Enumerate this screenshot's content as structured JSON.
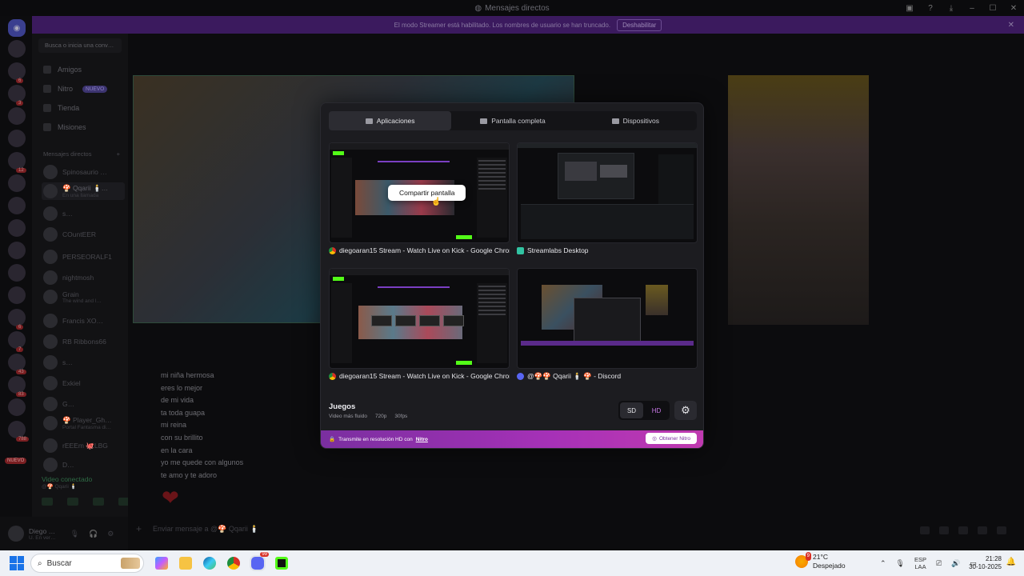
{
  "window": {
    "title": "Mensajes directos",
    "title_icon": "discord-icon"
  },
  "streamer_banner": {
    "text": "El modo Streamer está habilitado. Los nombres de usuario se han truncado.",
    "button": "Deshabilitar"
  },
  "rail": {
    "badges": [
      "6",
      "3",
      "12",
      "6",
      "7",
      "43",
      "83",
      "788"
    ],
    "nuevo_label": "NUEVO"
  },
  "sidebar": {
    "search_placeholder": "Busca o inicia una conv…",
    "nav": [
      {
        "label": "Amigos",
        "icon": "friends-icon"
      },
      {
        "label": "Nitro",
        "icon": "nitro-icon",
        "tag": "NUEVO"
      },
      {
        "label": "Tienda",
        "icon": "shop-icon"
      },
      {
        "label": "Misiones",
        "icon": "quests-icon"
      }
    ],
    "dm_header": "Mensajes directos",
    "dm_add": "+",
    "dms": [
      {
        "name": "Spinosaurio …",
        "sub": ""
      },
      {
        "name": "🍄 Qqarii 🕯️…",
        "sub": "En una llamada"
      },
      {
        "name": "s…",
        "sub": ""
      },
      {
        "name": "COuntEER",
        "sub": ""
      },
      {
        "name": "PERSEORALF1",
        "sub": ""
      },
      {
        "name": "nightmosh",
        "sub": ""
      },
      {
        "name": "Grain",
        "sub": "The wind and l…"
      },
      {
        "name": "Francis XO…",
        "sub": ""
      },
      {
        "name": "RB Ribbons66",
        "sub": ""
      },
      {
        "name": "s…",
        "sub": ""
      },
      {
        "name": "Exkiel",
        "sub": ""
      },
      {
        "name": "G…",
        "sub": ""
      },
      {
        "name": "🍄 Player_Gh…",
        "sub": "Portal Fantasma di…"
      },
      {
        "name": "rEEEm 🐙LBG",
        "sub": ""
      },
      {
        "name": "D…",
        "sub": ""
      }
    ],
    "voice": {
      "status": "Video conectado",
      "channel": "@🍄 Qqarii 🕯️"
    },
    "user": {
      "name": "Diego …",
      "sub": "U. En ver…"
    }
  },
  "chat": {
    "messages": [
      "mi niña hermosa",
      "eres lo mejor",
      "de mi vida",
      "ta toda guapa",
      "mi reina",
      "con su brillito",
      "en la cara",
      "yo me quede con algunos",
      "te amo y te adoro"
    ],
    "heart": "❤",
    "composer_placeholder": "Enviar mensaje a @🍄 Qqarii 🕯️"
  },
  "modal": {
    "tabs": [
      {
        "label": "Aplicaciones",
        "icon": "window-icon",
        "active": true
      },
      {
        "label": "Pantalla completa",
        "icon": "monitor-icon",
        "active": false
      },
      {
        "label": "Dispositivos",
        "icon": "camera-icon",
        "active": false
      }
    ],
    "sources": [
      {
        "label": "diegoaran15 Stream - Watch Live on Kick - Google Chrome",
        "app_icon": "chrome-icon"
      },
      {
        "label": "Streamlabs Desktop",
        "app_icon": "streamlabs-icon"
      },
      {
        "label": "diegoaran15 Stream - Watch Live on Kick - Google Chrome",
        "app_icon": "chrome-icon"
      },
      {
        "label": "@🍄🍄 Qqarii 🕯️ 🍄 - Discord",
        "app_icon": "discord-icon"
      }
    ],
    "share_tooltip": "Compartir pantalla",
    "games": {
      "title": "Juegos",
      "subtitle": "Video más fluido",
      "resolution": "720p",
      "fps": "30fps"
    },
    "quality": {
      "sd": "SD",
      "hd": "HD",
      "selected": "SD"
    },
    "nitro": {
      "text": "Transmite en resolución HD con",
      "link": "Nitro",
      "button": "Obtener Nitro"
    }
  },
  "taskbar": {
    "search_label": "Buscar",
    "apps": [
      "copilot-icon",
      "file-explorer-icon",
      "edge-icon",
      "chrome-icon",
      "discord-icon",
      "kick-icon"
    ],
    "discord_badge": "99",
    "weather": {
      "temp": "21°C",
      "condition": "Despejado",
      "badge": "9"
    },
    "lang": {
      "line1": "ESP",
      "line2": "LAA"
    },
    "time": "21:28",
    "date": "30-10-2025"
  },
  "colors": {
    "nitro_gradient_start": "#7a2fa0",
    "nitro_gradient_end": "#c03ab0",
    "hd_accent": "#c778e6",
    "kick_green": "#53fc18",
    "banner_purple": "#3b1a5e"
  }
}
